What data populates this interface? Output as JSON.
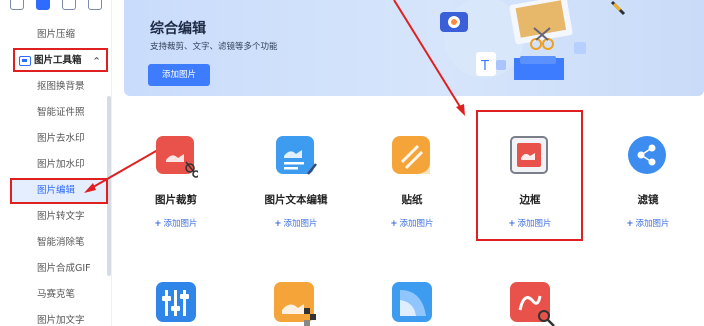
{
  "sidebar": {
    "items": [
      {
        "label": "图片压缩"
      },
      {
        "label": "图片工具箱"
      },
      {
        "label": "抠图换背景"
      },
      {
        "label": "智能证件照"
      },
      {
        "label": "图片去水印"
      },
      {
        "label": "图片加水印"
      },
      {
        "label": "图片编辑"
      },
      {
        "label": "图片转文字"
      },
      {
        "label": "智能消除笔"
      },
      {
        "label": "图片合成GIF"
      },
      {
        "label": "马赛克笔"
      },
      {
        "label": "图片加文字"
      }
    ]
  },
  "banner": {
    "title": "综合编辑",
    "subtitle": "支持裁剪、文字、滤镜等多个功能",
    "button": "添加图片"
  },
  "tools": [
    {
      "name": "图片裁剪",
      "add": "添加图片"
    },
    {
      "name": "图片文本编辑",
      "add": "添加图片"
    },
    {
      "name": "贴纸",
      "add": "添加图片"
    },
    {
      "name": "边框",
      "add": "添加图片"
    },
    {
      "name": "滤镜",
      "add": "添加图片"
    }
  ],
  "colors": {
    "accent": "#2f6bff",
    "annotation": "#e02020",
    "add_link": "#3d6fe0"
  }
}
